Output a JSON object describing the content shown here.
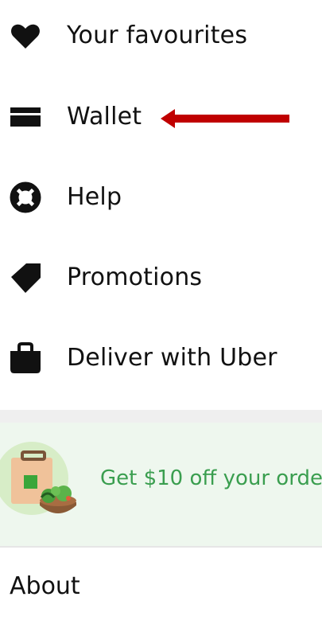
{
  "menu": {
    "items": [
      {
        "label": "Your favourites",
        "icon": "heart-icon"
      },
      {
        "label": "Wallet",
        "icon": "wallet-icon"
      },
      {
        "label": "Help",
        "icon": "lifebuoy-icon"
      },
      {
        "label": "Promotions",
        "icon": "tag-icon"
      },
      {
        "label": "Deliver with Uber",
        "icon": "bag-icon"
      }
    ]
  },
  "promo": {
    "text": "Get $10 off your orde",
    "icon": "grocery-bag-icon",
    "text_color": "#3a9e4f",
    "background": "#eef7ee"
  },
  "about": {
    "label": "About"
  },
  "annotation": {
    "icon": "red-arrow-icon",
    "color": "#c00000"
  }
}
